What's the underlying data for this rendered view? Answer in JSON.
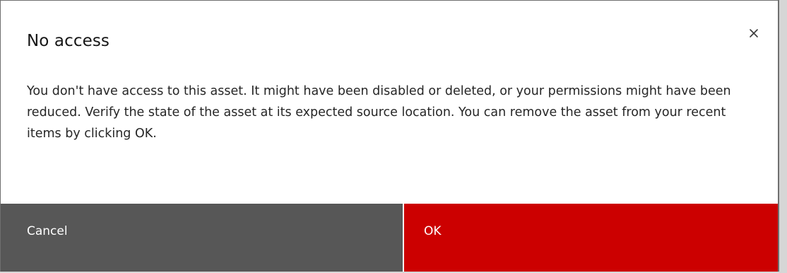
{
  "dialog": {
    "title": "No access",
    "close_icon": "close-icon",
    "message": "You don't have access to this asset. It might have been disabled or deleted, or your permissions might have been reduced. Verify the state of the asset at its expected source location. You can remove the asset from your recent items by clicking OK.",
    "cancel_label": "Cancel",
    "ok_label": "OK"
  },
  "colors": {
    "cancel_button": "#575757",
    "ok_button": "#cc0000",
    "title_text": "#161616"
  }
}
